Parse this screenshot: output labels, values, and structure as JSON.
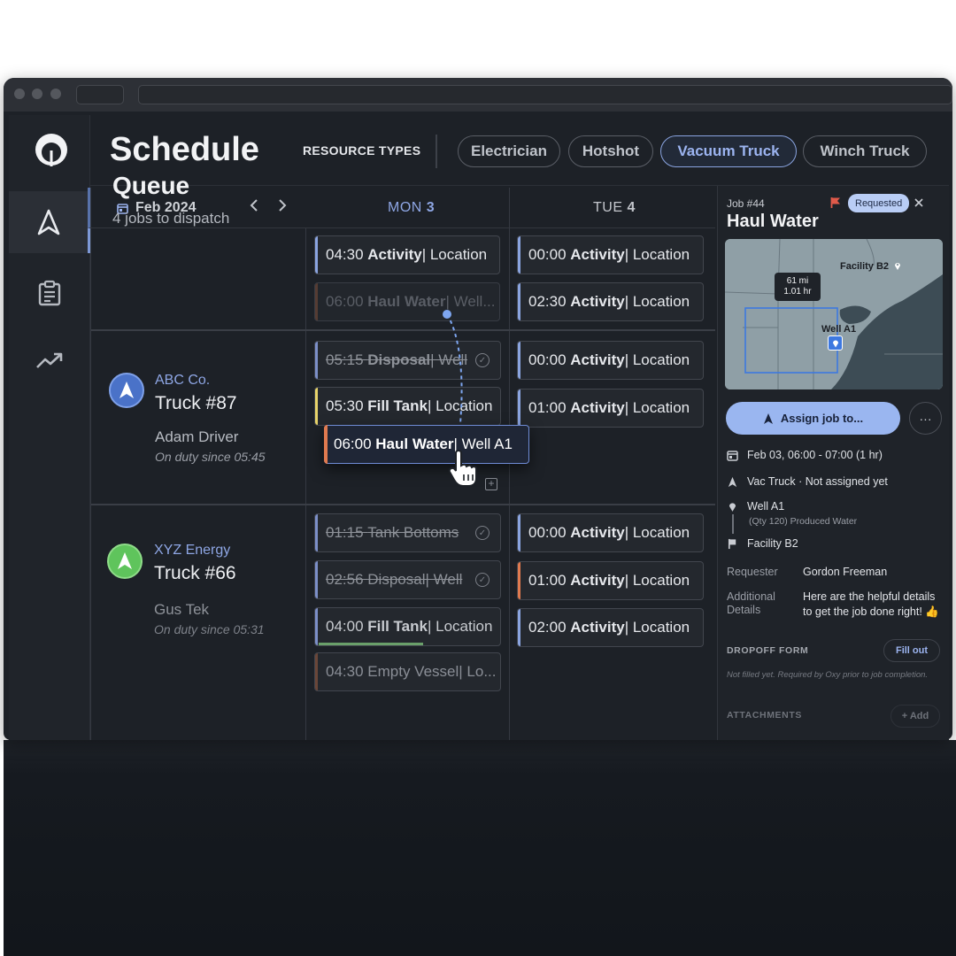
{
  "header": {
    "title": "Schedule",
    "resource_types_label": "RESOURCE TYPES",
    "chips": [
      "Electrician",
      "Hotshot",
      "Vacuum Truck",
      "Winch Truck"
    ],
    "active_chip": "Vacuum Truck"
  },
  "calendar": {
    "month": "Feb 2024",
    "days": [
      {
        "dow": "MON",
        "num": "3",
        "active": true
      },
      {
        "dow": "TUE",
        "num": "4",
        "active": false
      }
    ]
  },
  "queue": {
    "title": "Queue",
    "subtitle": "4 jobs to dispatch",
    "mon": [
      {
        "time": "04:30",
        "title": "Activity",
        "rest": " | Location"
      },
      {
        "time": "06:00",
        "title": "Haul Water",
        "rest": " | Well..."
      }
    ],
    "tue": [
      {
        "time": "00:00",
        "title": "Activity",
        "rest": " | Location"
      },
      {
        "time": "02:30",
        "title": "Activity",
        "rest": " | Location"
      }
    ]
  },
  "trucks": [
    {
      "company": "ABC Co.",
      "truck": "Truck #87",
      "driver": "Adam Driver",
      "duty": "On duty since 05:45",
      "mon": [
        {
          "time": "05:15",
          "title": "Disposal",
          "rest": " | Well"
        },
        {
          "time": "05:30",
          "title": "Fill Tank",
          "rest": " | Location"
        }
      ],
      "tue": [
        {
          "time": "00:00",
          "title": "Activity",
          "rest": " | Location"
        },
        {
          "time": "01:00",
          "title": "Activity",
          "rest": " | Location"
        }
      ]
    },
    {
      "company": "XYZ Energy",
      "truck": "Truck #66",
      "driver": "Gus Tek",
      "duty": "On duty since 05:31",
      "mon": [
        {
          "time": "01:15",
          "title": "Tank Bottoms",
          "rest": ""
        },
        {
          "time": "02:56",
          "title": "Disposal",
          "rest": " | Well"
        },
        {
          "time": "04:00",
          "title": "Fill Tank",
          "rest": " | Location"
        },
        {
          "time": "04:30",
          "title": "Empty Vessel",
          "rest": " | Lo..."
        }
      ],
      "tue": [
        {
          "time": "00:00",
          "title": "Activity",
          "rest": " | Location"
        },
        {
          "time": "01:00",
          "title": "Activity",
          "rest": " | Location"
        },
        {
          "time": "02:00",
          "title": "Activity",
          "rest": " | Location"
        }
      ]
    }
  ],
  "dragging": {
    "time": "06:00",
    "title": "Haul Water",
    "rest": " | Well A1"
  },
  "detail": {
    "job_number": "Job #44",
    "title": "Haul Water",
    "status": "Requested",
    "map": {
      "distance": "61 mi",
      "duration": "1.01 hr",
      "facility": "Facility B2",
      "well": "Well A1"
    },
    "assign_label": "Assign job to...",
    "more_label": "···",
    "datetime": "Feb 03, 06:00 - 07:00  (1 hr)",
    "vehicle": "Vac Truck · Not assigned yet",
    "pickup": "Well A1",
    "pickup_sub": "(Qty 120) Produced Water",
    "dropoff": "Facility B2",
    "requester_label": "Requester",
    "requester": "Gordon Freeman",
    "additional_label": "Additional Details",
    "additional": "Here are the helpful details to get the job done right! 👍",
    "dropoff_form_label": "DROPOFF FORM",
    "fill_out_label": "Fill out",
    "dropoff_note": "Not filled yet. Required by Oxy prior to job completion.",
    "attachments_label": "ATTACHMENTS",
    "add_label": "+ Add"
  },
  "colors": {
    "accent_blue": "#8aa4e0",
    "accent_orange": "#e07a4f",
    "accent_yellow": "#e8d46a",
    "accent_purple": "#7c8fc8",
    "accent_green": "#6aa06a",
    "status_badge": "#b9cdf5"
  },
  "icons": {
    "nav": [
      "navigation-arrow-icon",
      "clipboard-icon",
      "trending-up-icon"
    ]
  }
}
